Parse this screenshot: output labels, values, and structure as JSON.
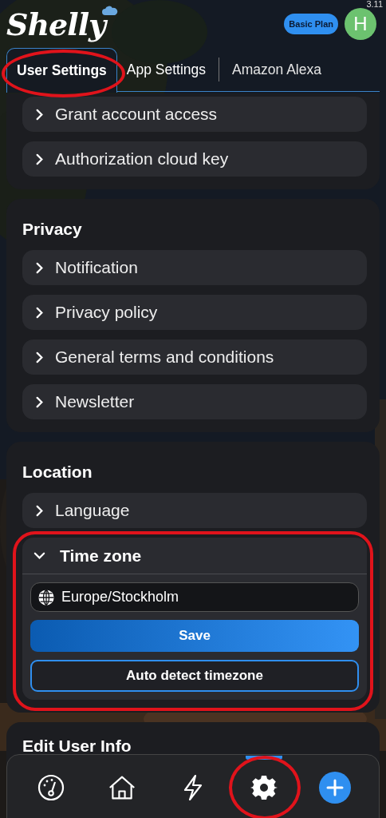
{
  "status": {
    "time": "3.11"
  },
  "header": {
    "logo": "Shelly",
    "plan_badge": "Basic Plan",
    "avatar": "H"
  },
  "tabs": [
    {
      "label": "User Settings",
      "selected": true,
      "circled": true
    },
    {
      "label": "App Settings",
      "selected": false,
      "circled": false
    },
    {
      "label": "Amazon Alexa",
      "selected": false,
      "circled": false
    }
  ],
  "sections": [
    {
      "items": [
        {
          "label": "Grant account access",
          "expanded": false
        },
        {
          "label": "Authorization cloud key",
          "expanded": false
        }
      ]
    },
    {
      "title": "Privacy",
      "items": [
        {
          "label": "Notification",
          "expanded": false
        },
        {
          "label": "Privacy policy",
          "expanded": false
        },
        {
          "label": "General terms and conditions",
          "expanded": false
        },
        {
          "label": "Newsletter",
          "expanded": false
        }
      ]
    },
    {
      "title": "Location",
      "items": [
        {
          "label": "Language",
          "expanded": false
        },
        {
          "label": "Time zone",
          "expanded": true,
          "circled": true,
          "field": {
            "value": "Europe/Stockholm"
          },
          "buttons": [
            {
              "label": "Save",
              "kind": "primary"
            },
            {
              "label": "Auto detect timezone",
              "kind": "outline"
            }
          ]
        }
      ]
    },
    {
      "title": "Edit User Info"
    }
  ],
  "nav": [
    {
      "kind": "gauge",
      "selected": false,
      "circled": false
    },
    {
      "kind": "home",
      "selected": false,
      "circled": false
    },
    {
      "kind": "bolt",
      "selected": false,
      "circled": false
    },
    {
      "kind": "gear",
      "selected": true,
      "circled": true
    },
    {
      "kind": "add",
      "selected": false,
      "circled": false
    }
  ]
}
